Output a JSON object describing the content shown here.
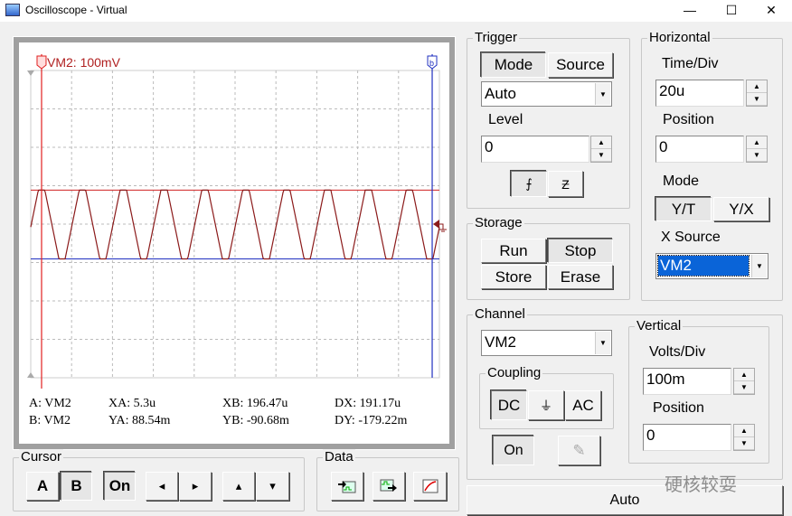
{
  "window": {
    "title": "Oscilloscope - Virtual",
    "minimize": "—",
    "maximize": "☐",
    "close": "✕"
  },
  "screen": {
    "channel_label": "VM2: 100mV",
    "cursor_a_tag": "a",
    "cursor_b_tag": "b",
    "trace_color": "#8b1a1a",
    "cursor_a_color": "#e02020",
    "cursor_b_color": "#2030c0",
    "time_per_div_us": 20,
    "volts_per_div_mV": 100,
    "cursor_a_time_us": 5.3,
    "cursor_b_time_us": 196.47,
    "level_high_mV": 88.54,
    "level_low_mV": -90.68
  },
  "readout": {
    "a": "A:  VM2",
    "b": "B:  VM2",
    "xa": "XA:  5.3u",
    "ya": "YA:  88.54m",
    "xb": "XB:  196.47u",
    "yb": "YB:  -90.68m",
    "dx": "DX:  191.17u",
    "dy": "DY:  -179.22m"
  },
  "cursor": {
    "title": "Cursor",
    "a": "A",
    "b": "B",
    "on": "On",
    "left": "◂",
    "right": "▸",
    "up": "▴",
    "down": "▾"
  },
  "data": {
    "title": "Data"
  },
  "trigger": {
    "title": "Trigger",
    "mode": "Mode",
    "source": "Source",
    "mode_value": "Auto",
    "level_label": "Level",
    "level_value": "0",
    "rising": "⨍",
    "falling": "Ƶ"
  },
  "storage": {
    "title": "Storage",
    "run": "Run",
    "stop": "Stop",
    "store": "Store",
    "erase": "Erase"
  },
  "horizontal": {
    "title": "Horizontal",
    "time_div_label": "Time/Div",
    "time_div_value": "20u",
    "position_label": "Position",
    "position_value": "0",
    "mode_label": "Mode",
    "yt": "Y/T",
    "yx": "Y/X",
    "xsource_label": "X Source",
    "xsource_value": "VM2"
  },
  "channel": {
    "title": "Channel",
    "value": "VM2",
    "coupling_title": "Coupling",
    "dc": "DC",
    "gnd": "⏚",
    "ac": "AC",
    "on": "On",
    "probe": "✎"
  },
  "vertical": {
    "title": "Vertical",
    "volts_div_label": "Volts/Div",
    "volts_div_value": "100m",
    "position_label": "Position",
    "position_value": "0"
  },
  "auto_button": "Auto",
  "watermark": "硬核较耍"
}
